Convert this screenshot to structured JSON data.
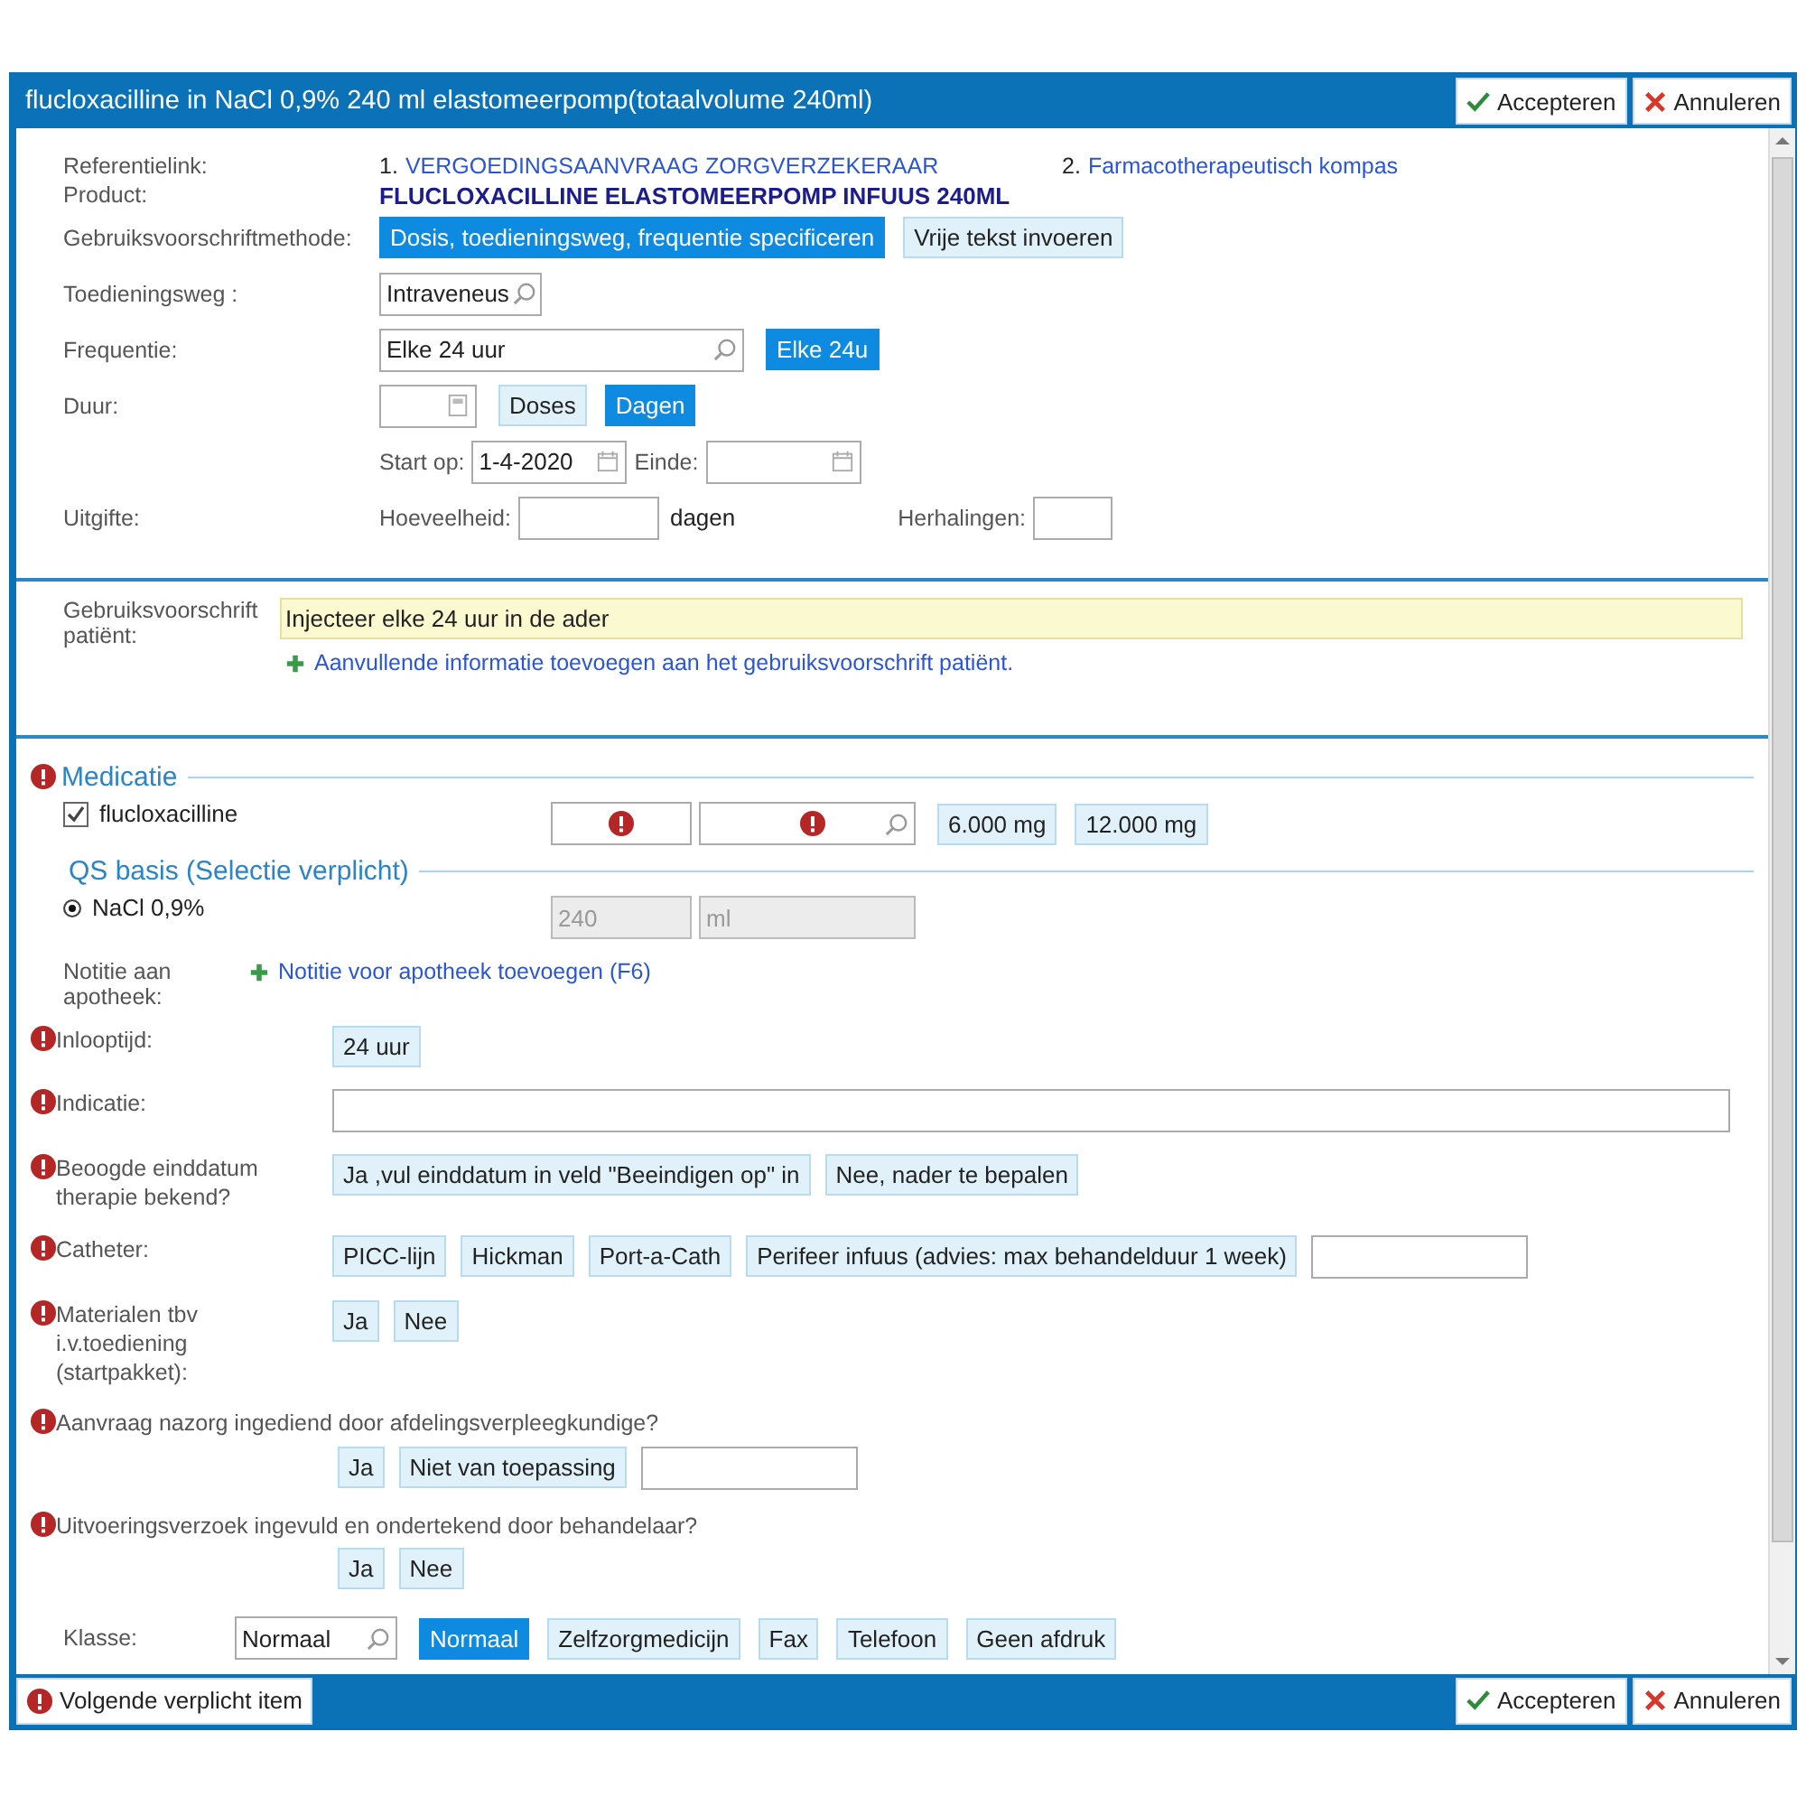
{
  "window": {
    "title": "flucloxacilline in NaCl 0,9% 240 ml elastomeerpomp(totaalvolume 240ml)"
  },
  "header_buttons": [
    {
      "kind": "accept",
      "label": "Accepteren"
    },
    {
      "kind": "cancel",
      "label": "Annuleren"
    }
  ],
  "reference": {
    "label": "Referentielink:",
    "links": [
      {
        "number": "1.",
        "text": "VERGOEDINGSAANVRAAG ZORGVERZEKERAAR"
      },
      {
        "number": "2.",
        "text": "Farmacotherapeutisch kompas"
      }
    ]
  },
  "product": {
    "label": "Product:",
    "value": "FLUCLOXACILLINE ELASTOMEERPOMP INFUUS 240ML"
  },
  "method": {
    "label": "Gebruiksvoorschriftmethode:",
    "options": [
      {
        "label": "Dosis, toedieningsweg, frequentie specificeren",
        "selected": true
      },
      {
        "label": "Vrije tekst invoeren",
        "selected": false
      }
    ]
  },
  "route": {
    "label": "Toedieningsweg :",
    "value": "Intraveneus"
  },
  "frequency": {
    "label": "Frequentie:",
    "value": "Elke 24 uur",
    "options": [
      {
        "label": "Elke 24u",
        "selected": true
      }
    ]
  },
  "duration": {
    "label": "Duur:",
    "options": [
      {
        "label": "Doses",
        "selected": false
      },
      {
        "label": "Dagen",
        "selected": true
      }
    ],
    "start_label": "Start op:",
    "start_value": "1-4-2020",
    "end_label": "Einde:"
  },
  "dispense": {
    "label": "Uitgifte:",
    "quantity_label": "Hoeveelheid:",
    "unit": "dagen",
    "repeats_label": "Herhalingen:"
  },
  "patient_instruction": {
    "label": "Gebruiksvoorschrift patiënt:",
    "value": "Injecteer elke 24 uur in de ader",
    "add_link": "Aanvullende informatie toevoegen aan het gebruiksvoorschrift patiënt."
  },
  "medication": {
    "heading": "Medicatie",
    "required": true,
    "item": {
      "name": "flucloxacilline",
      "checked": true
    },
    "doses": [
      {
        "label": "6.000 mg",
        "selected": false
      },
      {
        "label": "12.000 mg",
        "selected": false
      }
    ]
  },
  "qs_basis": {
    "heading": "QS basis (Selectie verplicht)",
    "item": {
      "name": "NaCl 0,9%",
      "selected": true
    },
    "amount": "240",
    "unit": "ml"
  },
  "note": {
    "label": "Notitie aan apotheek:",
    "add_link": "Notitie voor apotheek toevoegen (F6)"
  },
  "questions": [
    {
      "label": "Inlooptijd:",
      "required": true,
      "kind": "choice",
      "options": [
        {
          "label": "24 uur",
          "selected": false
        }
      ]
    },
    {
      "label": "Indicatie:",
      "required": true,
      "kind": "text"
    },
    {
      "label": "Beoogde einddatum therapie bekend?",
      "required": true,
      "kind": "choice",
      "options": [
        {
          "label": "Ja ,vul einddatum in veld \"Beeindigen op\" in",
          "selected": false
        },
        {
          "label": "Nee, nader te bepalen",
          "selected": false
        }
      ]
    },
    {
      "label": "Catheter:",
      "required": true,
      "kind": "choicefield",
      "options": [
        {
          "label": "PICC-lijn",
          "selected": false
        },
        {
          "label": "Hickman",
          "selected": false
        },
        {
          "label": "Port-a-Cath",
          "selected": false
        },
        {
          "label": "Perifeer infuus (advies: max behandelduur 1 week)",
          "selected": false
        }
      ]
    },
    {
      "label": "Materialen tbv i.v.toediening (startpakket):",
      "required": true,
      "kind": "choice",
      "options": [
        {
          "label": "Ja",
          "selected": false
        },
        {
          "label": "Nee",
          "selected": false
        }
      ]
    },
    {
      "label": "Aanvraag nazorg ingediend door afdelingsverpleegkundige?",
      "required": true,
      "kind": "stackedfield",
      "options": [
        {
          "label": "Ja",
          "selected": false
        },
        {
          "label": "Niet van toepassing",
          "selected": false
        }
      ]
    },
    {
      "label": "Uitvoeringsverzoek ingevuld en ondertekend door behandelaar?",
      "required": true,
      "kind": "stacked",
      "options": [
        {
          "label": "Ja",
          "selected": false
        },
        {
          "label": "Nee",
          "selected": false
        }
      ]
    }
  ],
  "klasse": {
    "label": "Klasse:",
    "value": "Normaal",
    "options": [
      {
        "label": "Normaal",
        "selected": true
      },
      {
        "label": "Zelfzorgmedicijn",
        "selected": false
      },
      {
        "label": "Fax",
        "selected": false
      },
      {
        "label": "Telefoon",
        "selected": false
      },
      {
        "label": "Geen afdruk",
        "selected": false
      }
    ]
  },
  "footer": {
    "next_required": "Volgende verplicht item",
    "buttons": [
      {
        "kind": "accept",
        "label": "Accepteren"
      },
      {
        "kind": "cancel",
        "label": "Annuleren"
      }
    ]
  }
}
